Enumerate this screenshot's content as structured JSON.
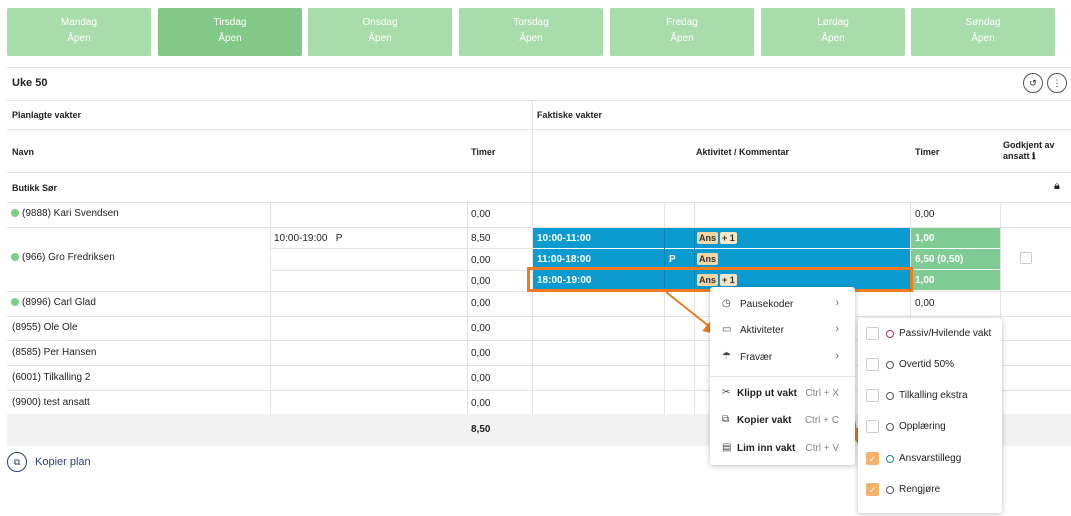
{
  "days": [
    {
      "name": "Mandag",
      "status": "Åpen"
    },
    {
      "name": "Tirsdag",
      "status": "Åpen"
    },
    {
      "name": "Onsdag",
      "status": "Åpen"
    },
    {
      "name": "Torsdag",
      "status": "Åpen"
    },
    {
      "name": "Fredag",
      "status": "Åpen"
    },
    {
      "name": "Lørdag",
      "status": "Åpen"
    },
    {
      "name": "Søndag",
      "status": "Åpen"
    }
  ],
  "week": {
    "title": "Uke 50",
    "history_icon": "history-icon",
    "more_icon": "more-vertical-icon"
  },
  "headers": {
    "planned": "Planlagte vakter",
    "actual": "Faktiske vakter",
    "name": "Navn",
    "hours": "Timer",
    "activity": "Aktivitet / Kommentar",
    "hours_actual": "Timer",
    "approved": "Godkjent av ansatt",
    "info_icon": "ℹ"
  },
  "group": {
    "name": "Butikk Sør",
    "lock_icon": "lock-icon"
  },
  "employees": [
    {
      "name": "(9888) Kari Svendsen",
      "planned_hours": "0,00",
      "actual_hours": "0,00"
    },
    {
      "name": "(966) Gro Fredriksen"
    },
    {
      "name": "(8996) Carl Glad",
      "planned_hours": "0,00",
      "actual_hours": "0,00"
    },
    {
      "name": "(8955) Ole Ole",
      "planned_hours": "0,00"
    },
    {
      "name": "(8585) Per Hansen",
      "planned_hours": "0,00"
    },
    {
      "name": "(6001) Tilkalling 2",
      "planned_hours": "0,00"
    },
    {
      "name": "(9900) test ansatt",
      "planned_hours": "0,00"
    }
  ],
  "gro_planned": {
    "shift": "10:00-19:00",
    "flag": "P",
    "hours": [
      "8,50",
      "0,00",
      "0,00"
    ]
  },
  "gro_actual": [
    {
      "time": "10:00-11:00",
      "flag": "",
      "tags": [
        "Ans",
        "+ 1"
      ],
      "hours": "1,00"
    },
    {
      "time": "11:00-18:00",
      "flag": "P",
      "tags": [
        "Ans"
      ],
      "hours": "6,50 (0,50)"
    },
    {
      "time": "18:00-19:00",
      "flag": "",
      "tags": [
        "Ans",
        "+ 1"
      ],
      "hours": "1,00"
    }
  ],
  "total_hours": "8,50",
  "context_menu": {
    "items": [
      {
        "label": "Pausekoder",
        "icon": "clock-icon",
        "has_submenu": true
      },
      {
        "label": "Aktiviteter",
        "icon": "briefcase-icon",
        "has_submenu": true
      },
      {
        "label": "Fravær",
        "icon": "umbrella-icon",
        "has_submenu": true
      }
    ],
    "actions": [
      {
        "label": "Klipp ut vakt",
        "shortcut": "Ctrl + X",
        "icon": "scissors-icon"
      },
      {
        "label": "Kopier vakt",
        "shortcut": "Ctrl + C",
        "icon": "copy-icon"
      },
      {
        "label": "Lim inn vakt",
        "shortcut": "Ctrl + V",
        "icon": "paste-icon"
      }
    ]
  },
  "submenu": {
    "items": [
      {
        "label": "Passiv/Hvilende vakt",
        "checked": false,
        "color": "#c0287a"
      },
      {
        "label": "Overtid 50%",
        "checked": false,
        "color": "#555555"
      },
      {
        "label": "Tilkalling ekstra",
        "checked": false,
        "color": "#555555"
      },
      {
        "label": "Opplæring",
        "checked": false,
        "color": "#555555"
      },
      {
        "label": "Ansvarstillegg",
        "checked": true,
        "color": "#1a8a80"
      },
      {
        "label": "Rengjøre",
        "checked": true,
        "color": "#555555"
      }
    ]
  },
  "kopier_plan": "Kopier plan",
  "colors": {
    "tab": "#a8dcab",
    "tab_active": "#82c987",
    "shift_blue": "#0c9bd0",
    "hours_green": "#7ecc94",
    "highlight": "#f07a1e",
    "checked": "#f5b26a"
  }
}
